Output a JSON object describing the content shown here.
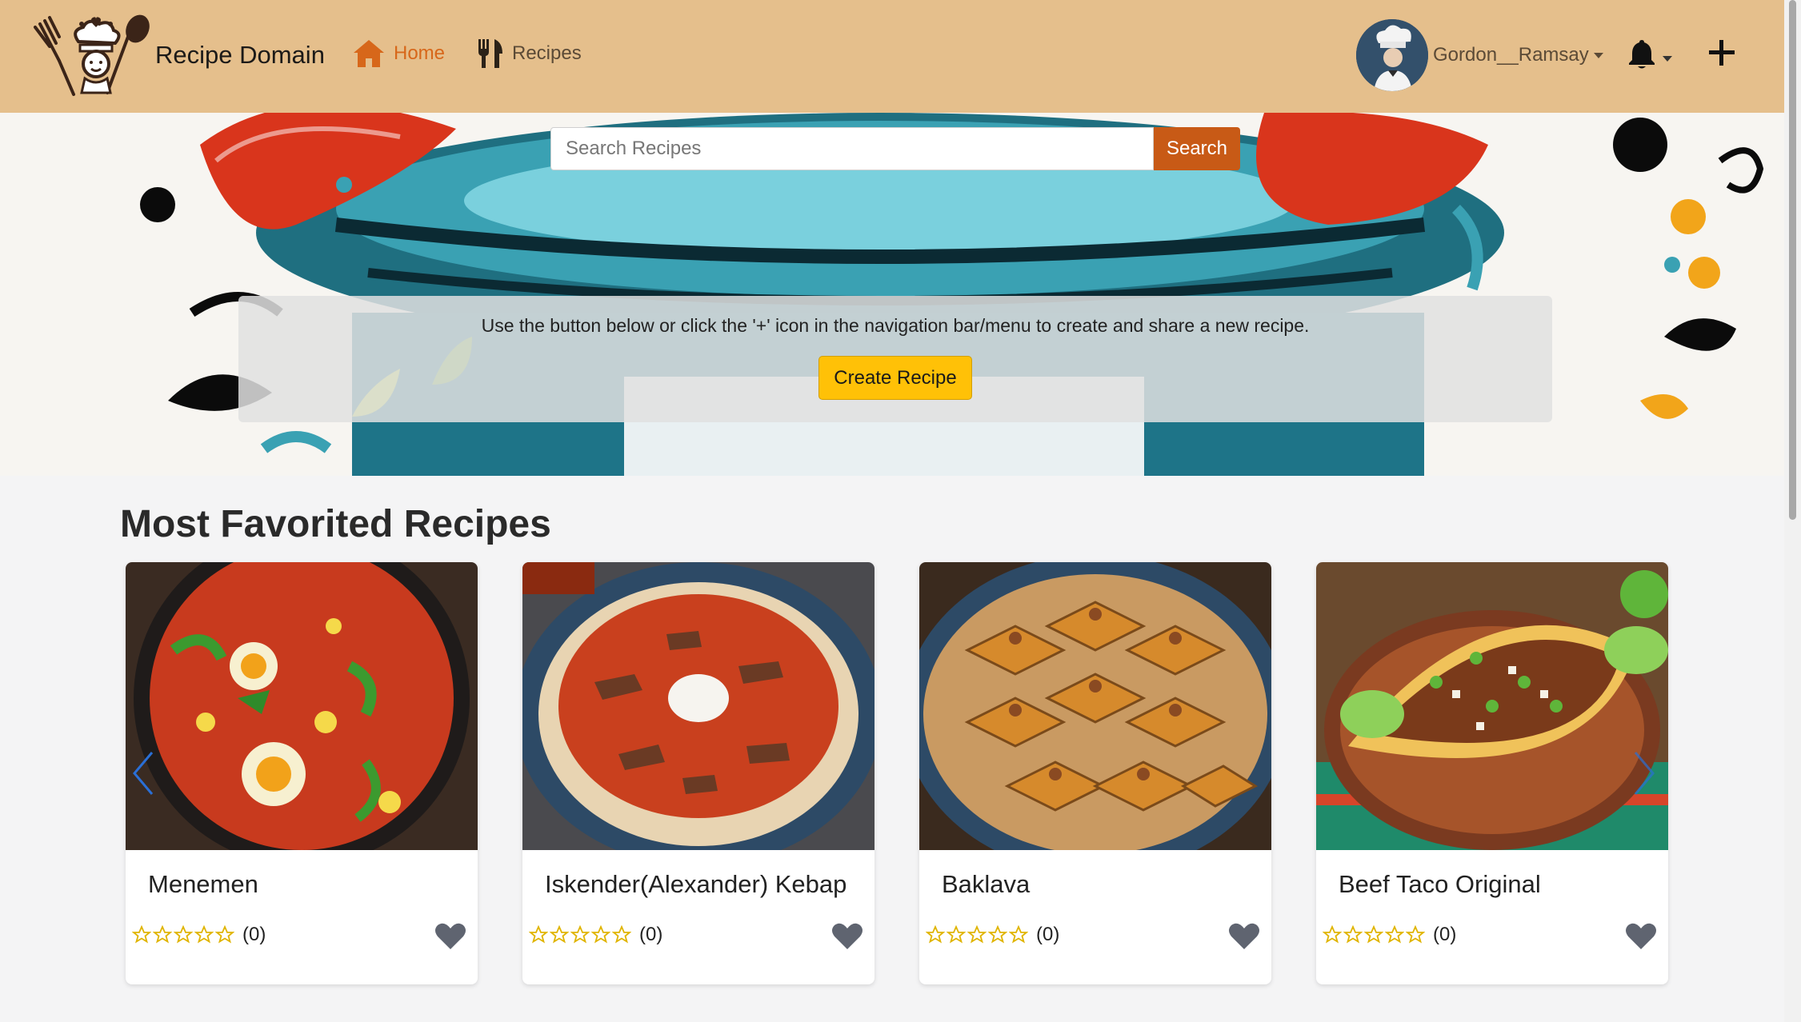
{
  "brand": {
    "name": "Recipe Domain",
    "logo": "chef-logo"
  },
  "nav": {
    "home_label": "Home",
    "recipes_label": "Recipes",
    "user_name": "Gordon__Ramsay"
  },
  "search": {
    "placeholder": "Search Recipes",
    "button_label": "Search"
  },
  "hero": {
    "message": "Use the button below or click the '+' icon in the navigation bar/menu to create and share a new recipe.",
    "button_label": "Create Recipe"
  },
  "section": {
    "title": "Most Favorited Recipes"
  },
  "recipes": [
    {
      "title": "Menemen",
      "rating": 0,
      "count": "(0)"
    },
    {
      "title": "Iskender(Alexander) Kebap",
      "rating": 0,
      "count": "(0)"
    },
    {
      "title": "Baklava",
      "rating": 0,
      "count": "(0)"
    },
    {
      "title": "Beef Taco Original",
      "rating": 0,
      "count": "(0)"
    }
  ],
  "colors": {
    "navbar": "#e5bf8c",
    "accent": "#d7671a",
    "search_button": "#c85a16",
    "create_button": "#ffc107",
    "star": "#f1c40f",
    "heart": "#5f6470"
  },
  "icons": [
    "chef-logo",
    "home-icon",
    "utensils-icon",
    "avatar",
    "bell-icon",
    "plus-icon",
    "star-icon",
    "heart-icon",
    "chevron-left-icon",
    "chevron-right-icon"
  ]
}
